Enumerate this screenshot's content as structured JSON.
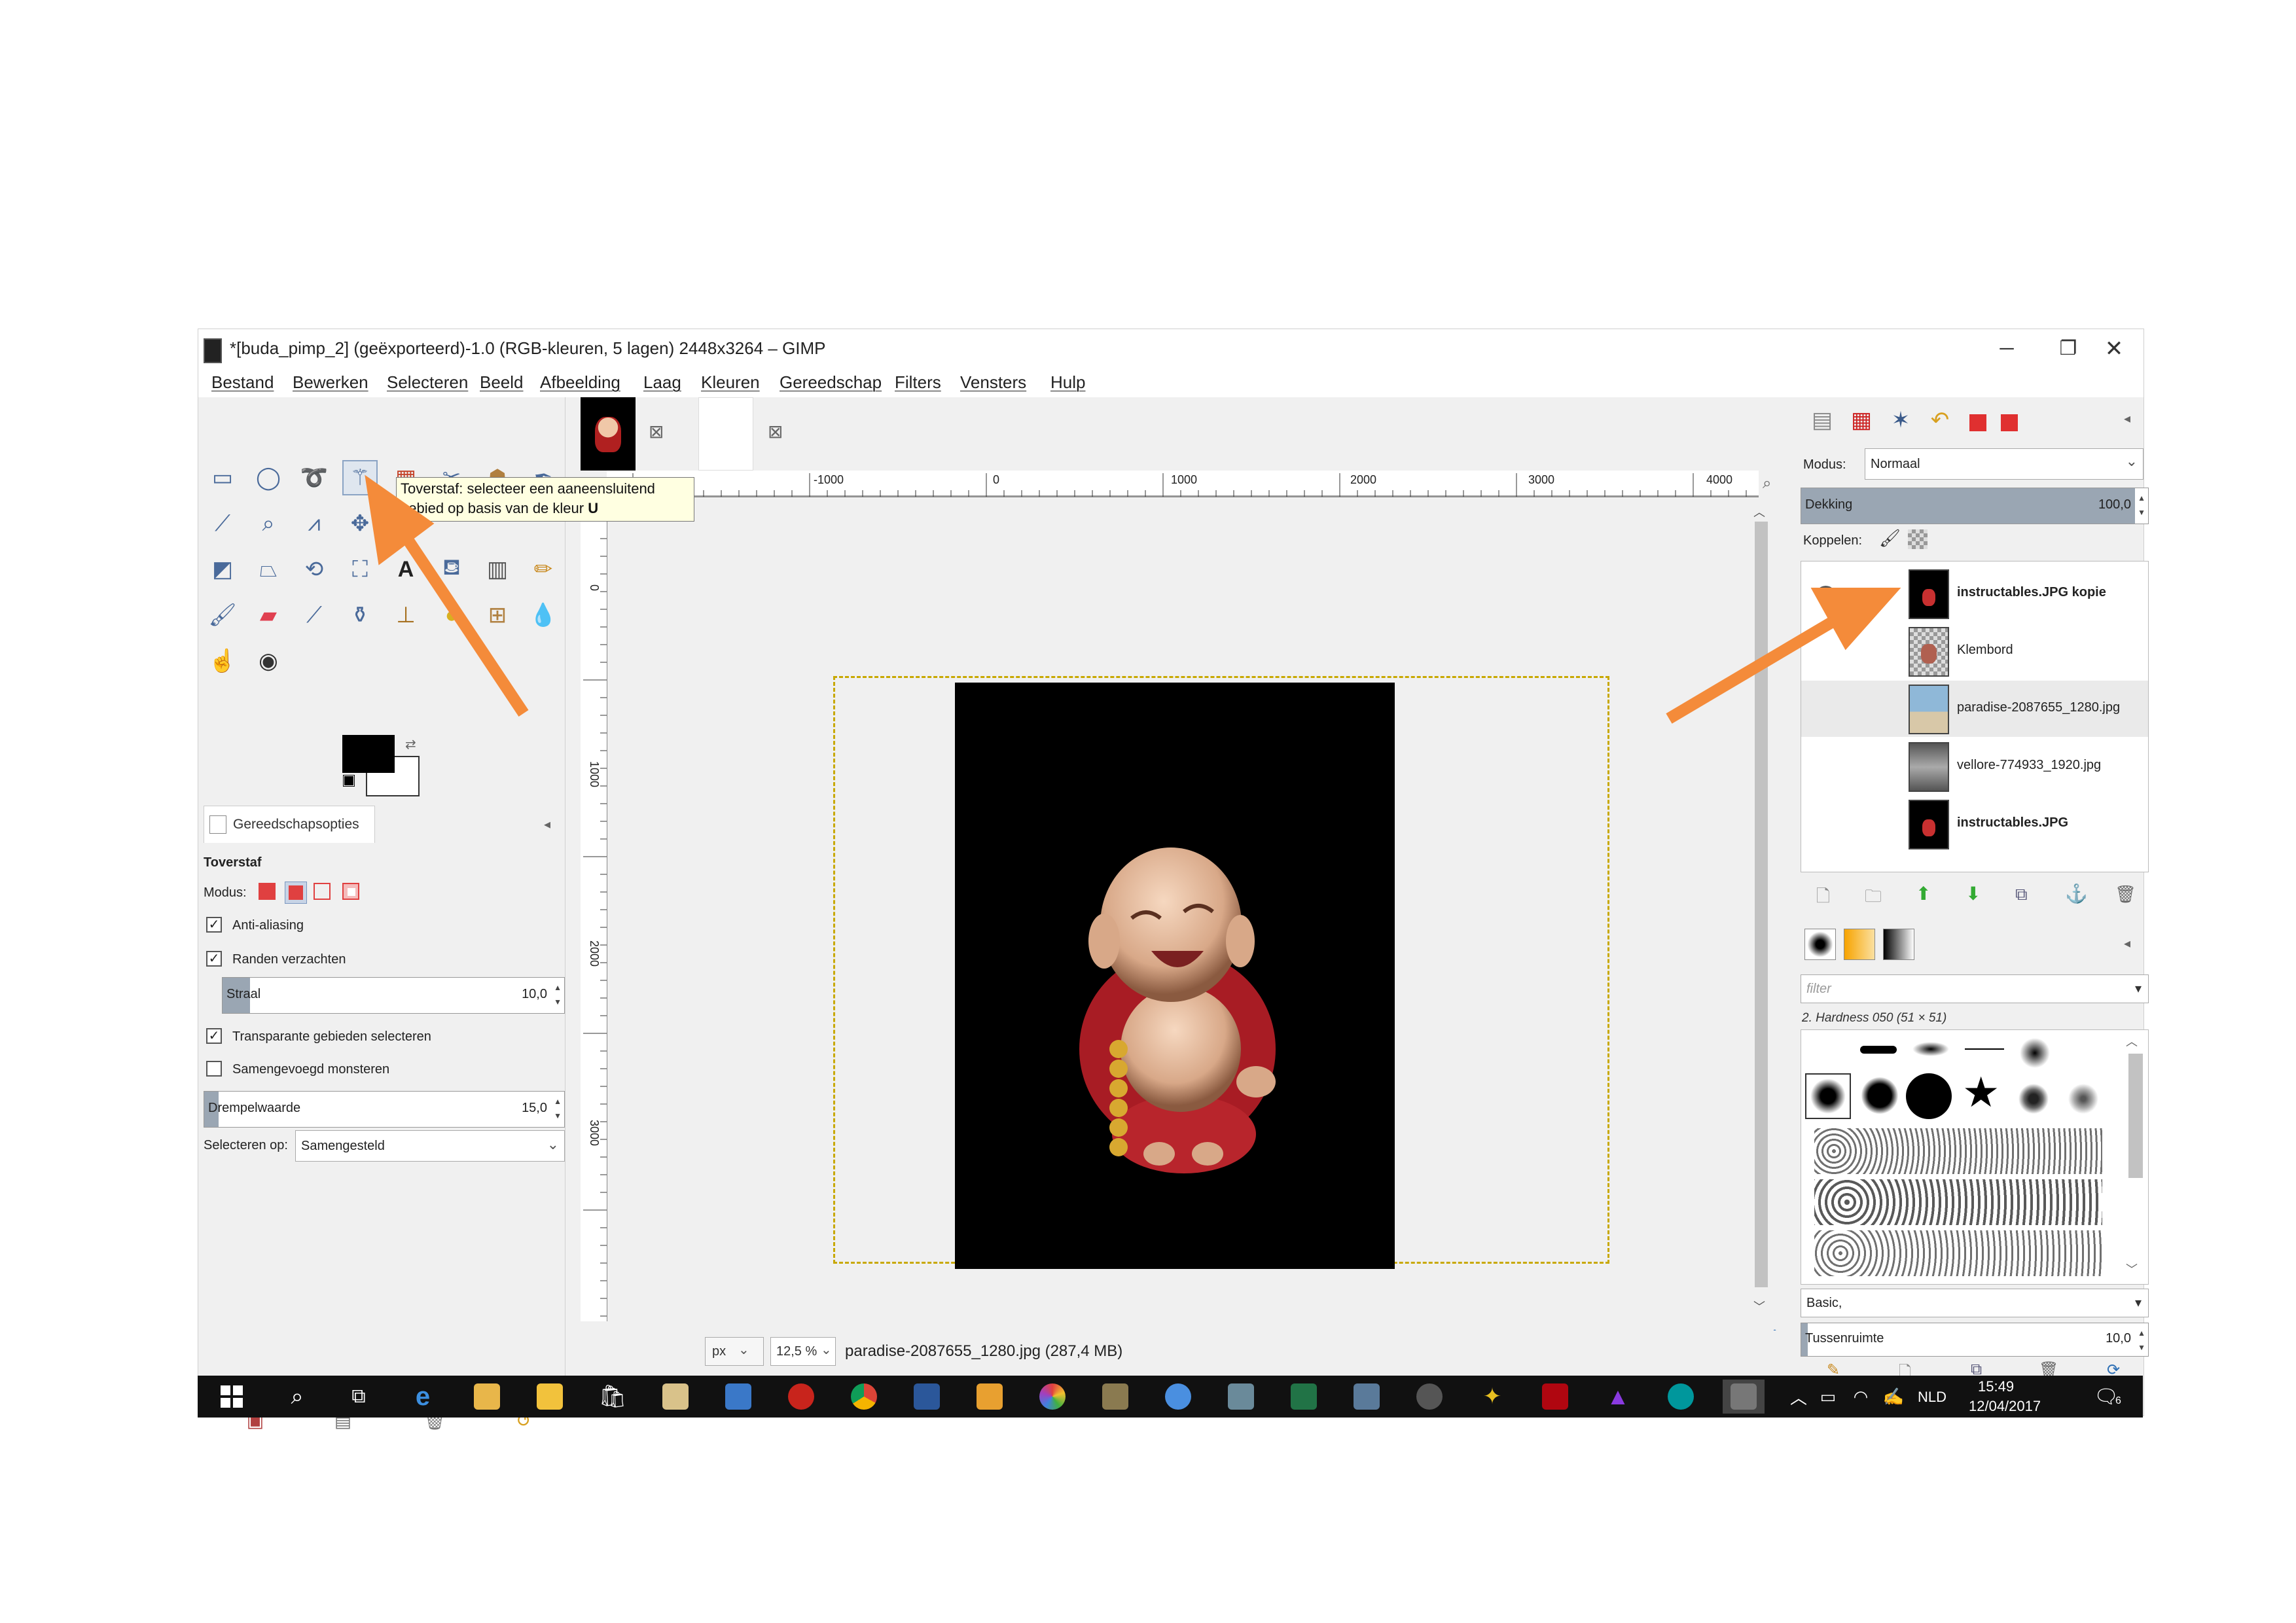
{
  "window": {
    "title": "*[buda_pimp_2] (geëxporteerd)-1.0 (RGB-kleuren, 5 lagen) 2448x3264 – GIMP",
    "minimize_glyph": "─",
    "maximize_glyph": "❐",
    "close_glyph": "✕"
  },
  "menu": [
    "Bestand",
    "Bewerken",
    "Selecteren",
    "Beeld",
    "Afbeelding",
    "Laag",
    "Kleuren",
    "Gereedschap",
    "Filters",
    "Vensters",
    "Hulp"
  ],
  "tooltip": {
    "line1": "Toverstaf: selecteer een aaneensluitend",
    "line2": "gebied op basis van de kleur",
    "shortcut": "U"
  },
  "tool_options": {
    "tab_label": "Gereedschapsopties",
    "tool_name": "Toverstaf",
    "mode_label": "Modus:",
    "antialias_label": "Anti-aliasing",
    "antialias_checked": true,
    "feather_label": "Randen verzachten",
    "feather_checked": true,
    "radius_label": "Straal",
    "radius_value": "10,0",
    "transparent_label": "Transparante gebieden selecteren",
    "transparent_checked": true,
    "sample_merged_label": "Samengevoegd monsteren",
    "sample_merged_checked": false,
    "threshold_label": "Drempelwaarde",
    "threshold_value": "15,0",
    "select_by_label": "Selecteren op:",
    "select_by_value": "Samengesteld"
  },
  "ruler": {
    "h_labels": [
      "-1000",
      "0",
      "1000",
      "2000",
      "3000",
      "4000"
    ],
    "v_labels": [
      "0",
      "1000",
      "2000",
      "3000"
    ]
  },
  "status_bar": {
    "unit": "px",
    "zoom": "12,5 %",
    "file_info": "paradise-2087655_1280.jpg (287,4 MB)"
  },
  "layers_panel": {
    "mode_label": "Modus:",
    "mode_value": "Normaal",
    "opacity_label": "Dekking",
    "opacity_value": "100,0",
    "lock_label": "Koppelen:",
    "layers": [
      {
        "name": "instructables.JPG kopie",
        "bold": true,
        "visible": true
      },
      {
        "name": "Klembord",
        "bold": false,
        "visible": false
      },
      {
        "name": "paradise-2087655_1280.jpg",
        "bold": false,
        "visible": false
      },
      {
        "name": "vellore-774933_1920.jpg",
        "bold": false,
        "visible": false
      },
      {
        "name": "instructables.JPG",
        "bold": true,
        "visible": false
      }
    ]
  },
  "brushes_panel": {
    "filter_placeholder": "filter",
    "brush_name": "2. Hardness 050 (51 × 51)",
    "preset": "Basic,",
    "spacing_label": "Tussenruimte",
    "spacing_value": "10,0"
  },
  "taskbar": {
    "language": "NLD",
    "time": "15:49",
    "date": "12/04/2017",
    "notification_count": "6"
  },
  "colors": {
    "annotation_arrow": "#f48b3a",
    "selection_border": "#c8a800",
    "tooltip_bg": "#ffffe1"
  }
}
